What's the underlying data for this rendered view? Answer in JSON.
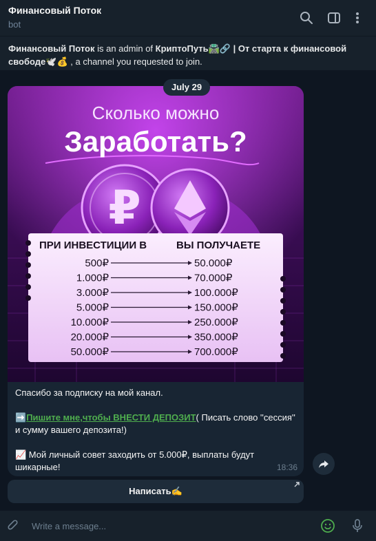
{
  "header": {
    "title": "Финансовый Поток",
    "subtitle": "bot",
    "icons": [
      "search-icon",
      "sidebar-toggle-icon",
      "more-vert-icon"
    ]
  },
  "notice": {
    "bot_name": "Финансовый Поток",
    "text_1": " is an admin of ",
    "channel": "КриптоПуть🛣️🔗 | От старта к финансовой свободе🕊️💰",
    "text_2": " , a channel you requested to join."
  },
  "date_chip": "July 29",
  "poster": {
    "line1": "Сколько можно",
    "line2": "Заработать?",
    "col_left": "ПРИ ИНВЕСТИЦИИ В",
    "col_right": "ВЫ ПОЛУЧАЕТЕ",
    "rows": [
      {
        "invest": "500₽",
        "get": "50.000₽"
      },
      {
        "invest": "1.000₽",
        "get": "70.000₽"
      },
      {
        "invest": "3.000₽",
        "get": "100.000₽"
      },
      {
        "invest": "5.000₽",
        "get": "150.000₽"
      },
      {
        "invest": "10.000₽",
        "get": "250.000₽"
      },
      {
        "invest": "20.000₽",
        "get": "350.000₽"
      },
      {
        "invest": "50.000₽",
        "get": "700.000₽"
      }
    ],
    "colors": {
      "bg": "#2a0a3d",
      "accent": "#c028e8",
      "card": "#f3d9fb"
    }
  },
  "message": {
    "line1": "Спасибо за подписку на мой канал.",
    "link_emoji": "➡️",
    "link_text": "Пишите мне,чтобы ВНЕСТИ ДЕПОЗИТ",
    "line2_rest": "( Писать слово ''сессия'' и сумму вашего депозита!)",
    "line3": "📈 Мой личный совет заходить от 5.000₽, выплаты будут шикарные!",
    "time": "18:36"
  },
  "keyboard_button": "Написать✍️",
  "composer": {
    "placeholder": "Write a message...",
    "icons": [
      "attach-icon",
      "emoji-icon",
      "mic-icon"
    ]
  },
  "colors": {
    "app_bg": "#0e1621",
    "panel": "#17212b",
    "bubble": "#182533",
    "link_green": "#4fae4e",
    "muted": "#708499"
  }
}
